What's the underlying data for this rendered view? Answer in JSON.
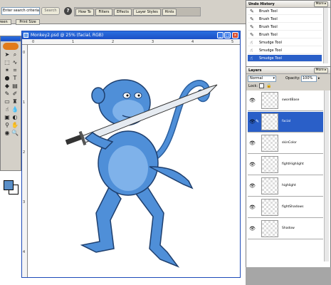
{
  "optionsbar": {
    "search_value": "Enter search criteria",
    "search_button": "Search",
    "palette_tabs": [
      "How To",
      "Filters",
      "Effects",
      "Layer Styles",
      "Hints"
    ],
    "screen_button": "reen",
    "print_size_button": "Print Size"
  },
  "document": {
    "title": "Monkey2.psd @ 25% (facial, RGB)",
    "ruler_marks": [
      "0",
      "1",
      "2",
      "3",
      "4",
      "5"
    ]
  },
  "history": {
    "title": "Undo History",
    "more": "More ▸",
    "items": [
      "Brush Tool",
      "Brush Tool",
      "Brush Tool",
      "Brush Tool",
      "Smudge Tool",
      "Smudge Tool",
      "Smudge Tool"
    ],
    "selected_index": 6
  },
  "layers": {
    "title": "Layers",
    "more": "More ▸",
    "blend_mode": "Normal",
    "opacity_label": "Opacity:",
    "opacity_value": "100%",
    "lock_label": "Lock:",
    "items": [
      "swordBase",
      "facial",
      "skinColor",
      "fightHighlight",
      "highlight",
      "fightShadows",
      "Shadow"
    ],
    "selected_index": 1
  },
  "colors": {
    "titlebar": "#1b4fc5",
    "selection": "#2a5fc8",
    "foreground": "#5a8fc8",
    "monkey": "#4f8fd8",
    "panel_bg": "#d4d0c8"
  }
}
